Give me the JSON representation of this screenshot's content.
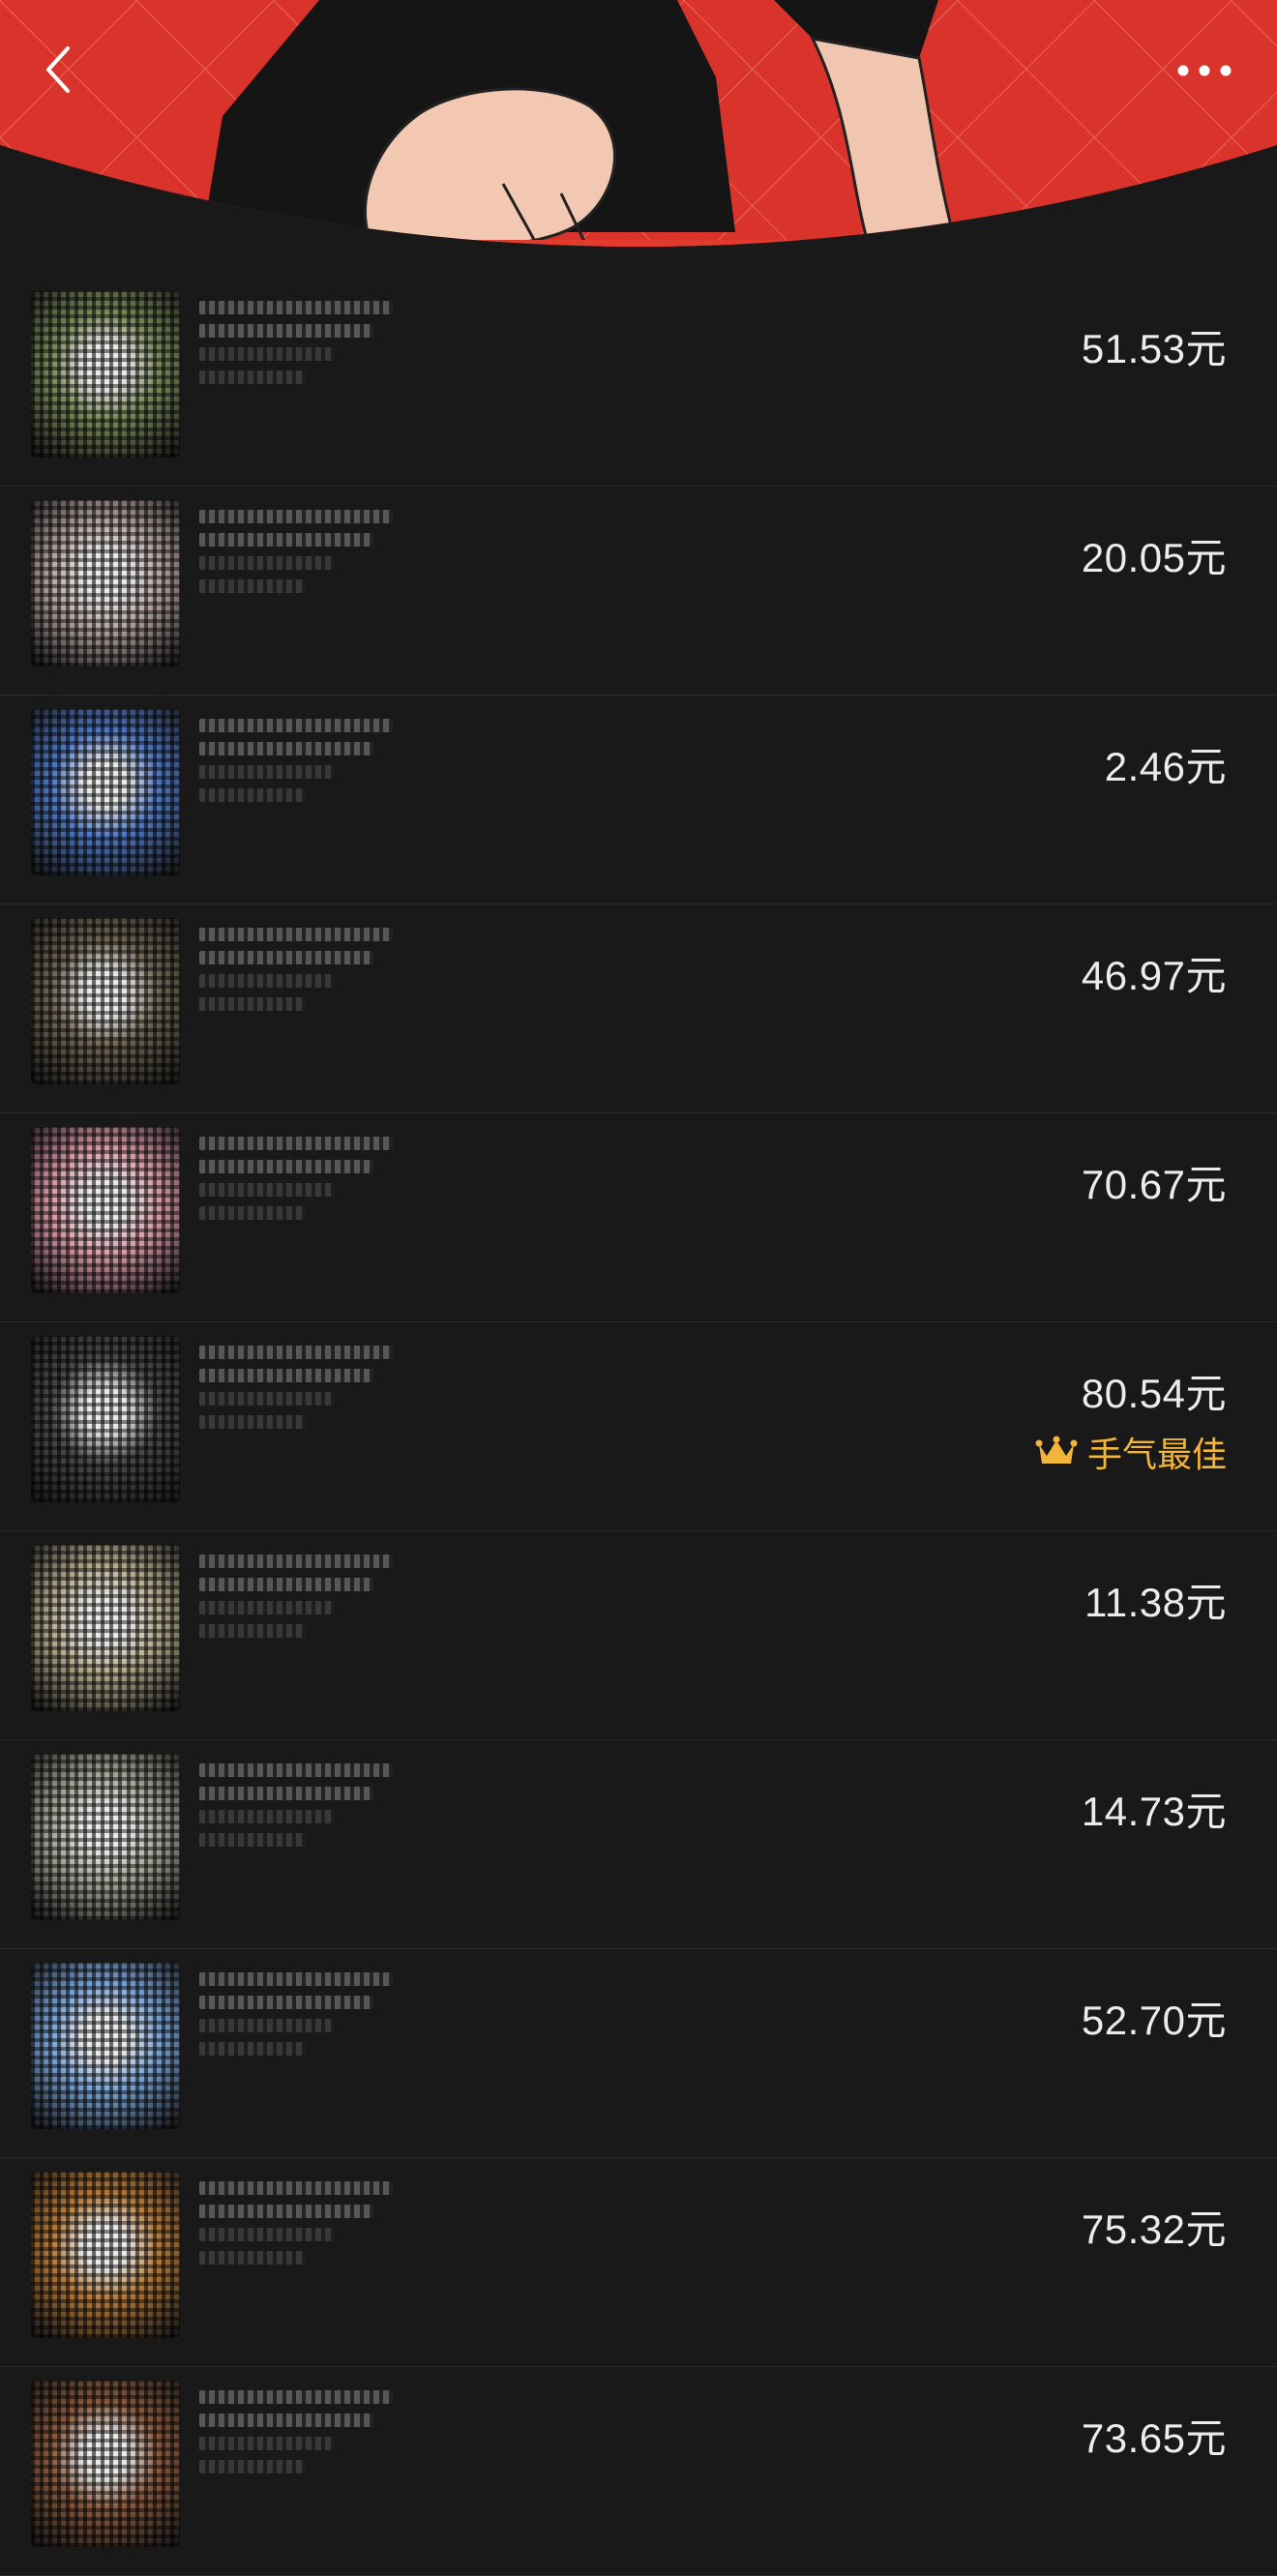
{
  "header": {
    "background_color": "#d9332c",
    "back_icon": "chevron-left-icon",
    "more_icon": "more-dots-icon"
  },
  "records": [
    {
      "amount": "51.53元",
      "avatar_color": "#7a8a5a",
      "best": false
    },
    {
      "amount": "20.05元",
      "avatar_color": "#b7a6a2",
      "best": false
    },
    {
      "amount": "2.46元",
      "avatar_color": "#4f78c2",
      "best": false
    },
    {
      "amount": "46.97元",
      "avatar_color": "#6f6552",
      "best": false
    },
    {
      "amount": "70.67元",
      "avatar_color": "#d89aa8",
      "best": false
    },
    {
      "amount": "80.54元",
      "avatar_color": "#4a4a4e",
      "best": true
    },
    {
      "amount": "11.38元",
      "avatar_color": "#b6ac8e",
      "best": false
    },
    {
      "amount": "14.73元",
      "avatar_color": "#a9a79a",
      "best": false
    },
    {
      "amount": "52.70元",
      "avatar_color": "#7aa4d6",
      "best": false
    },
    {
      "amount": "75.32元",
      "avatar_color": "#b57a3a",
      "best": false
    },
    {
      "amount": "73.65元",
      "avatar_color": "#8a5a3e",
      "best": false
    }
  ],
  "best_label": "手气最佳",
  "best_icon": "crown-icon",
  "best_color": "#f2b53a"
}
